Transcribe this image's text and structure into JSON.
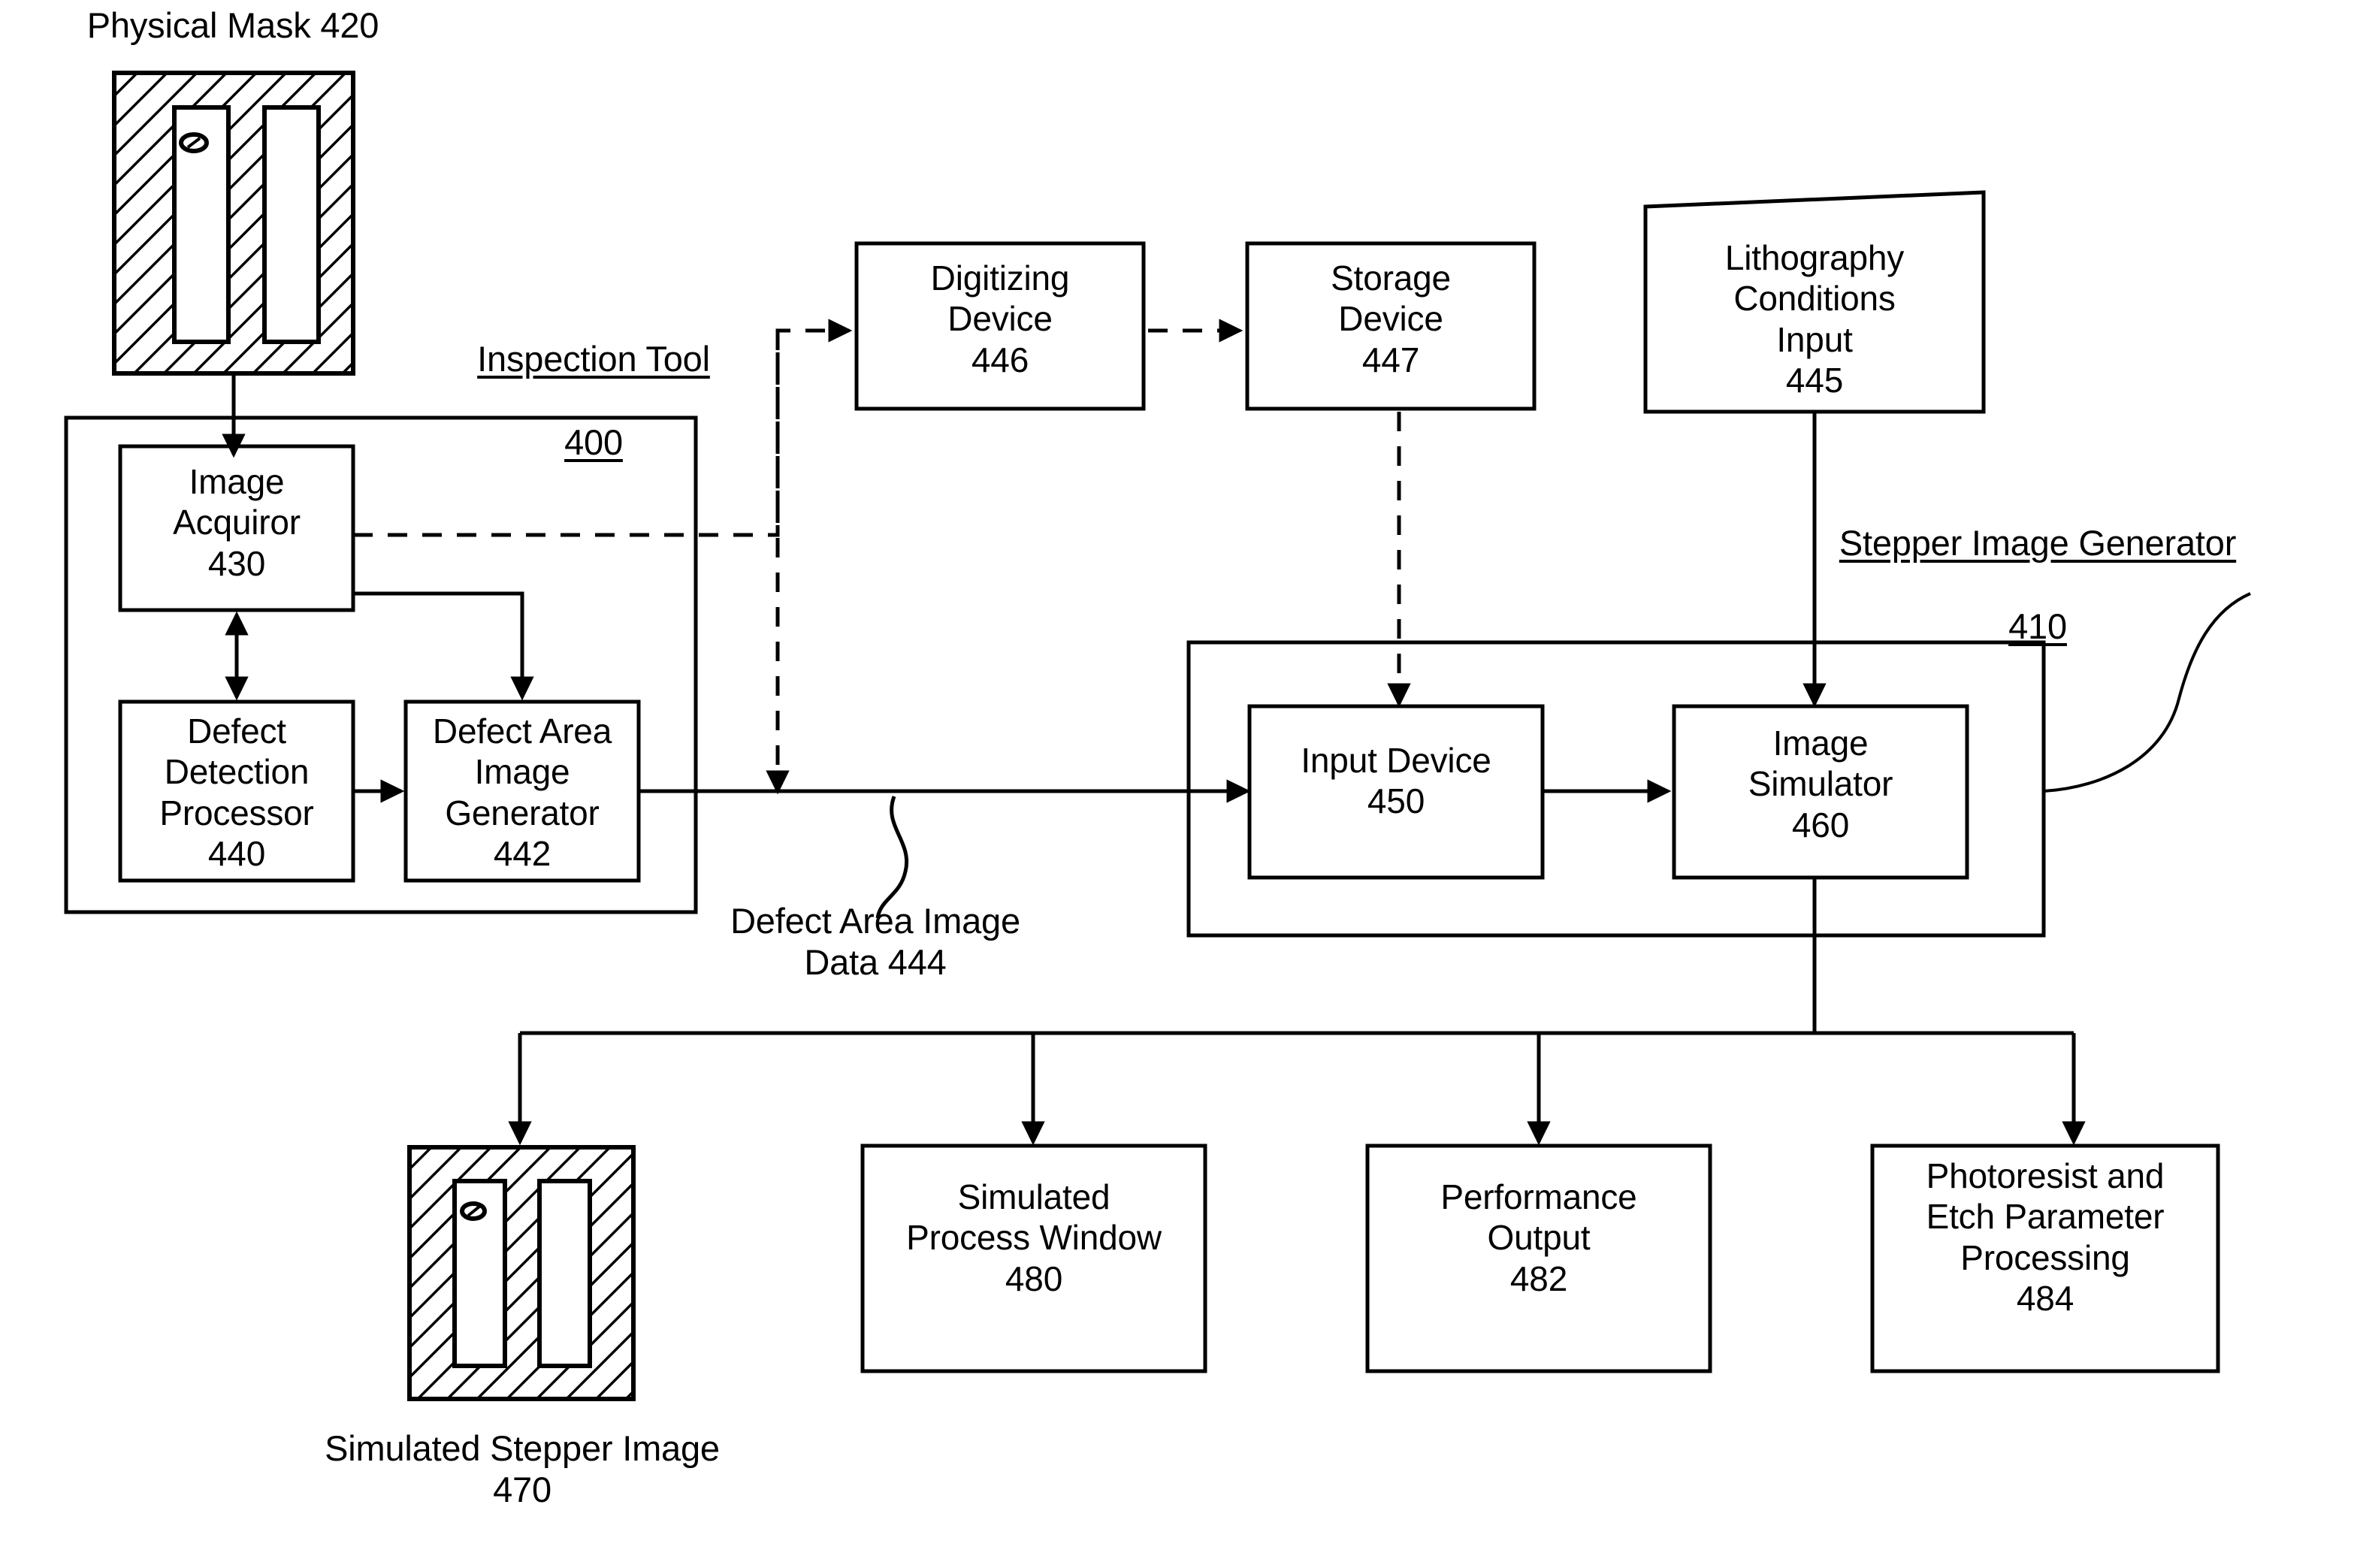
{
  "figure": {
    "domain": "patent-block-diagram",
    "title_caption": "Physical Mask 420"
  },
  "captions": {
    "physical_mask": "Physical Mask 420",
    "inspection_tool_name": "Inspection Tool",
    "inspection_tool_number": "400",
    "stepper_image_generator_name": "Stepper Image Generator",
    "stepper_image_generator_number": "410",
    "defect_area_image_data": "Defect Area Image\nData 444",
    "simulated_stepper_image": "Simulated Stepper Image\n470"
  },
  "blocks": {
    "image_acquiror": {
      "label": "Image\nAcquiror\n430",
      "ref": "430"
    },
    "defect_detection_processor": {
      "label": "Defect\nDetection\nProcessor\n440",
      "ref": "440"
    },
    "defect_area_image_generator": {
      "label": "Defect Area\nImage\nGenerator\n442",
      "ref": "442"
    },
    "digitizing_device": {
      "label": "Digitizing\nDevice\n446",
      "ref": "446"
    },
    "storage_device": {
      "label": "Storage\nDevice\n447",
      "ref": "447"
    },
    "lithography_conditions_input": {
      "label": "Lithography\nConditions\nInput\n445",
      "ref": "445"
    },
    "input_device": {
      "label": "Input Device\n450",
      "ref": "450"
    },
    "image_simulator": {
      "label": "Image\nSimulator\n460",
      "ref": "460"
    },
    "simulated_process_window": {
      "label": "Simulated\nProcess Window\n480",
      "ref": "480"
    },
    "performance_output": {
      "label": "Performance\nOutput\n482",
      "ref": "482"
    },
    "photoresist_etch": {
      "label": "Photoresist and\nEtch Parameter\nProcessing\n484",
      "ref": "484"
    }
  },
  "colors": {
    "ink": "#000000",
    "paper": "#ffffff"
  }
}
